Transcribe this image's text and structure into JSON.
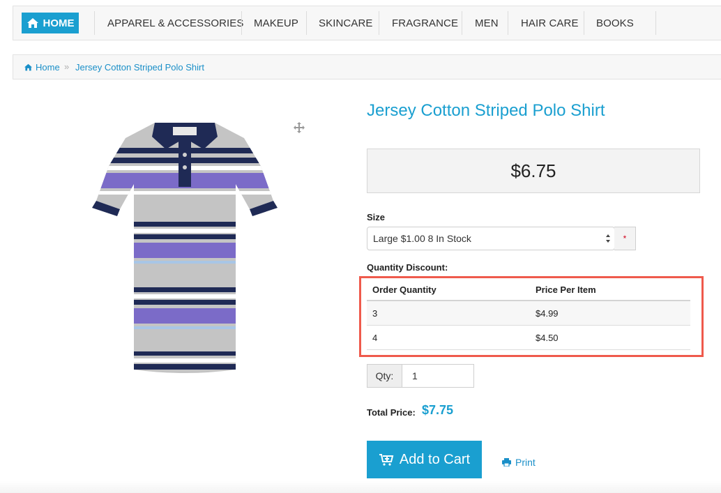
{
  "nav": {
    "home_label": "HOME",
    "items": [
      "APPAREL & ACCESSORIES",
      "MAKEUP",
      "SKINCARE",
      "FRAGRANCE",
      "MEN",
      "HAIR CARE",
      "BOOKS"
    ]
  },
  "breadcrumb": {
    "home": "Home",
    "current": "Jersey Cotton Striped Polo Shirt"
  },
  "product": {
    "title": "Jersey Cotton Striped Polo Shirt",
    "price": "$6.75",
    "size_label": "Size",
    "size_selected": "Large $1.00 8 In Stock",
    "required_marker": "*",
    "quantity_discount_label": "Quantity Discount:",
    "discount_headers": [
      "Order Quantity",
      "Price Per Item"
    ],
    "discount_rows": [
      {
        "qty": "3",
        "price": "$4.99"
      },
      {
        "qty": "4",
        "price": "$4.50"
      }
    ],
    "qty_label": "Qty:",
    "qty_value": "1",
    "total_label": "Total Price:",
    "total_value": "$7.75",
    "add_to_cart": "Add to Cart",
    "print": "Print"
  },
  "colors": {
    "accent": "#1a9fd0",
    "highlight": "#ef5a4c",
    "shirt_navy": "#1f2a55",
    "shirt_purple": "#7b6bc8",
    "shirt_grey": "#bdbdbd"
  }
}
